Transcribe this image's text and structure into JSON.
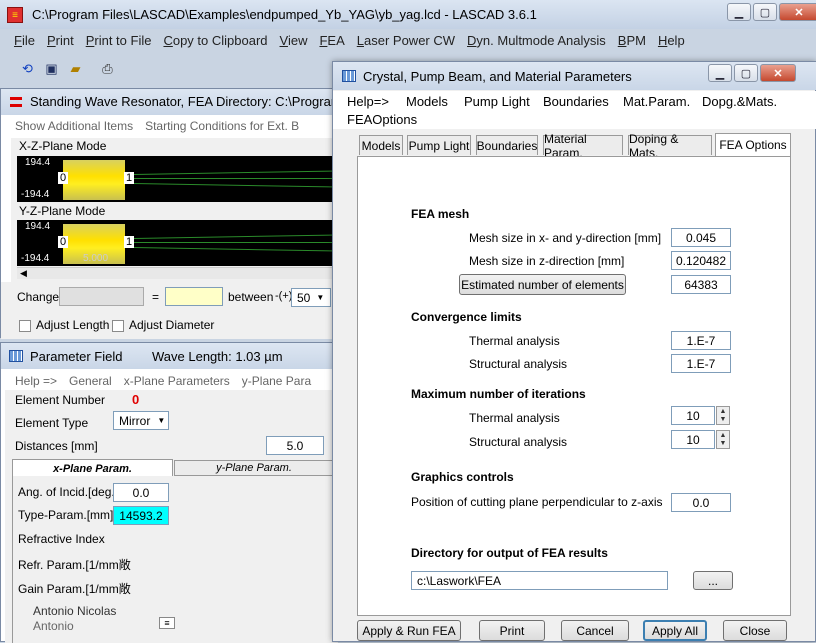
{
  "main": {
    "title": "C:\\Program Files\\LASCAD\\Examples\\endpumped_Yb_YAG\\yb_yag.lcd - LASCAD 3.6.1",
    "menu": [
      "File",
      "Print",
      "Print to File",
      "Copy to Clipboard",
      "View",
      "FEA",
      "Laser Power CW",
      "Dyn. Multmode Analysis",
      "BPM",
      "Help"
    ],
    "toolbar_icons": [
      "refresh-icon",
      "save-icon",
      "open-folder-icon",
      "printer-icon"
    ]
  },
  "resonator": {
    "title": "Standing Wave Resonator, FEA Directory: C:\\Program",
    "menu": [
      "Show Additional Items",
      "Starting Conditions for Ext. B"
    ],
    "xz_label": "X-Z-Plane Mode",
    "yz_label": "Y-Z-Plane Mode",
    "axis_top": "194.4",
    "axis_bottom": "-194.4",
    "axis_mid": "0.0",
    "elem_left": "0",
    "elem_right": "1",
    "hidden_value": "5.000",
    "change_label": "Change",
    "equals": "=",
    "between_label": "between",
    "plus_label": "-(+)",
    "between_value": "50",
    "adjust_length": "Adjust Length",
    "adjust_diameter": "Adjust Diameter"
  },
  "param": {
    "title": "Parameter Field",
    "wave_length": "Wave Length: 1.03  µm",
    "menu": [
      "Help =>",
      "General",
      "x-Plane Parameters",
      "y-Plane Para"
    ],
    "element_number_label": "Element Number",
    "element_number": "0",
    "element_type_label": "Element Type",
    "element_type": "Mirror",
    "distances_label": "Distances [mm]",
    "distances": "5.0",
    "tab_x": "x-Plane Param.",
    "tab_y": "y-Plane Param.",
    "ang_label": "Ang. of Incid.[deg.]",
    "ang": "0.0",
    "type_label": "Type-Param.[mm]",
    "type": "14593.2",
    "refr_index_label": "Refractive Index",
    "refr_param_label": "Refr. Param.[1/mm敞",
    "gain_param_label": "Gain Param.[1/mm敞",
    "behind1": "Antonio Nicolas",
    "behind2": "Antonio"
  },
  "dialog": {
    "title": "Crystal, Pump Beam, and Material Parameters",
    "menu": [
      "Help=>",
      "Models",
      "Pump Light",
      "Boundaries",
      "Mat.Param.",
      "Dopg.&Mats.",
      "FEAOptions"
    ],
    "tabs": [
      "Models",
      "Pump Light",
      "Boundaries",
      "Material Param.",
      "Doping & Mats.",
      "FEA Options"
    ],
    "fea_mesh": "FEA mesh",
    "mesh_xy_label": "Mesh size in x- and y-direction [mm]",
    "mesh_xy": "0.045",
    "mesh_z_label": "Mesh size in z-direction [mm]",
    "mesh_z": "0.120482",
    "estimate_button": "Estimated number of elements",
    "elements": "64383",
    "convergence": "Convergence limits",
    "thermal_label": "Thermal analysis",
    "thermal": "1.E-7",
    "structural_label": "Structural analysis",
    "structural": "1.E-7",
    "max_iter": "Maximum number of iterations",
    "thermal_iter": "10",
    "structural_iter": "10",
    "graphics": "Graphics controls",
    "cutting_label": "Position of cutting plane perpendicular to z-axis",
    "cutting": "0.0",
    "directory_label": "Directory for output of FEA results",
    "directory": "c:\\Laswork\\FEA",
    "browse": "...",
    "buttons": [
      "Apply  &  Run FEA",
      "Print",
      "Cancel",
      "Apply All",
      "Close"
    ]
  }
}
